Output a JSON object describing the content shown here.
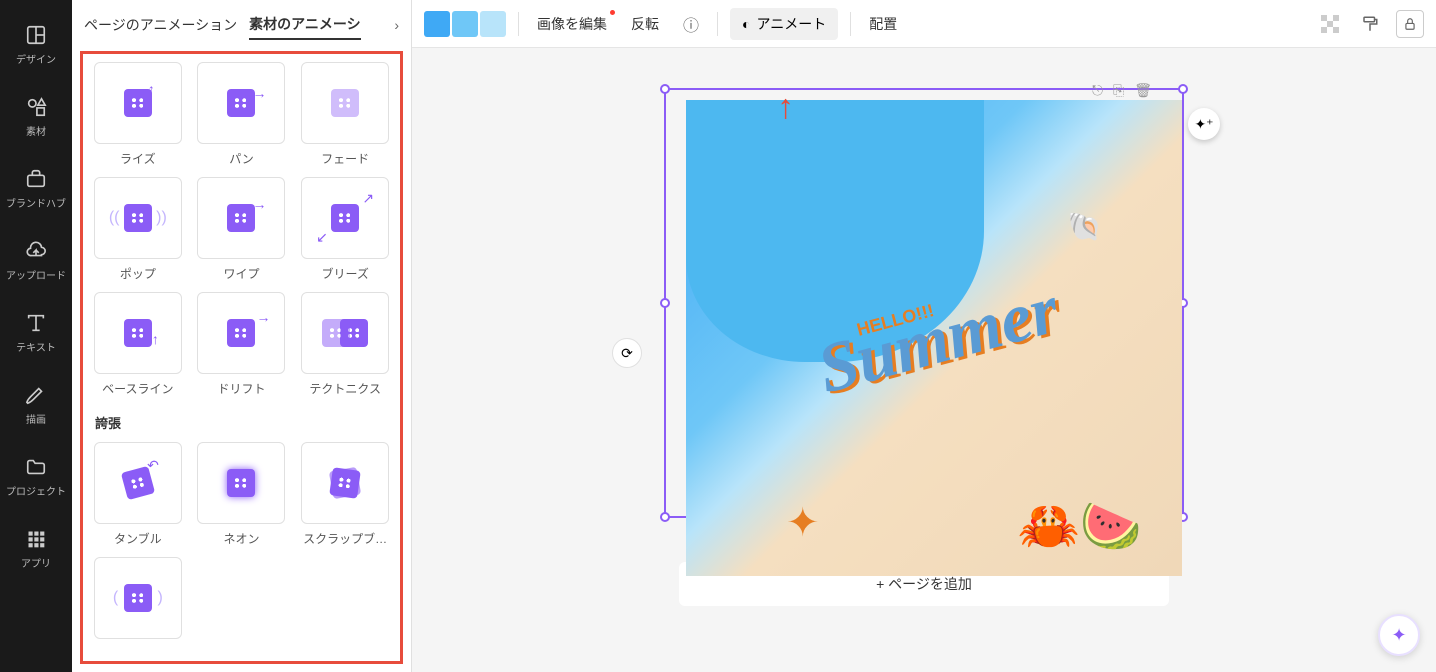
{
  "sidebar": {
    "items": [
      {
        "label": "デザイン",
        "icon": "layout"
      },
      {
        "label": "素材",
        "icon": "shapes"
      },
      {
        "label": "ブランドハブ",
        "icon": "briefcase"
      },
      {
        "label": "アップロード",
        "icon": "cloud"
      },
      {
        "label": "テキスト",
        "icon": "text"
      },
      {
        "label": "描画",
        "icon": "pen"
      },
      {
        "label": "プロジェクト",
        "icon": "folder"
      },
      {
        "label": "アプリ",
        "icon": "grid"
      }
    ]
  },
  "panel": {
    "tabs": {
      "page": "ページのアニメーション",
      "element": "素材のアニメーシ"
    },
    "section_emphasis": "誇張",
    "animations": [
      {
        "label": "ライズ"
      },
      {
        "label": "パン"
      },
      {
        "label": "フェード"
      },
      {
        "label": "ポップ"
      },
      {
        "label": "ワイプ"
      },
      {
        "label": "ブリーズ"
      },
      {
        "label": "ベースライン"
      },
      {
        "label": "ドリフト"
      },
      {
        "label": "テクトニクス"
      }
    ],
    "animations2": [
      {
        "label": "タンブル"
      },
      {
        "label": "ネオン"
      },
      {
        "label": "スクラップブ…"
      }
    ]
  },
  "toolbar": {
    "colors": [
      "#3fa9f5",
      "#6fc7f7",
      "#b8e4fa"
    ],
    "edit_image": "画像を編集",
    "flip": "反転",
    "animate": "アニメート",
    "position": "配置"
  },
  "canvas": {
    "hello_text": "HELLO!!!",
    "summer_text": "Summer",
    "add_page": "+ ページを追加"
  }
}
